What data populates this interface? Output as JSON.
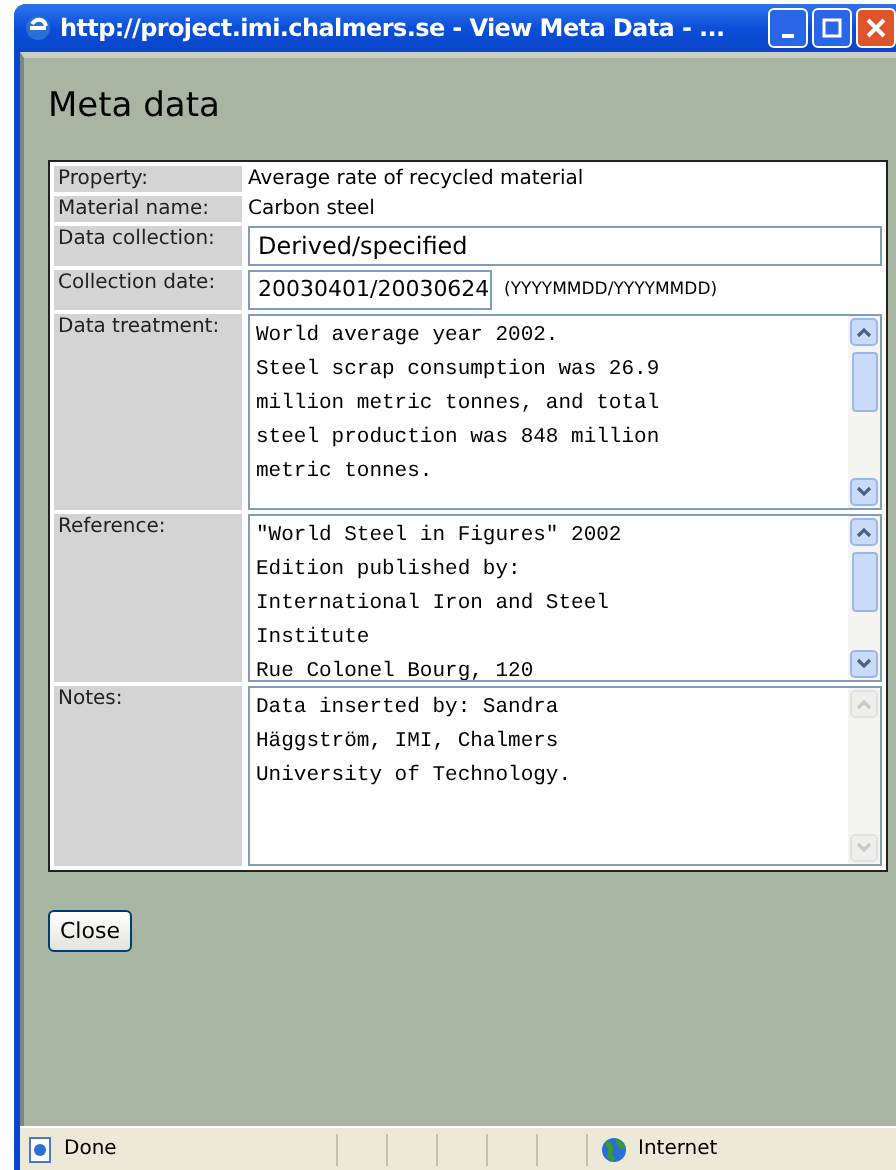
{
  "window": {
    "title": "http://project.imi.chalmers.se - View Meta Data - ..."
  },
  "heading": "Meta data",
  "rows": [
    {
      "kind": "text",
      "label": "Property:",
      "value": "Average rate of recycled material"
    },
    {
      "kind": "text",
      "label": "Material name:",
      "value": "Carbon steel"
    },
    {
      "kind": "input",
      "label": "Data collection:",
      "value": "Derived/specified"
    },
    {
      "kind": "date",
      "label": "Collection date:",
      "value": "20030401/20030624",
      "hint": "(YYYYMMDD/YYYYMMDD)"
    },
    {
      "kind": "textarea",
      "label": "Data treatment:",
      "value": "World average year 2002.\nSteel scrap consumption was 26.9\nmillion metric tonnes, and total\nsteel production was 848 million\nmetric tonnes.",
      "scrollable": true
    },
    {
      "kind": "textarea",
      "label": "Reference:",
      "value": "\"World Steel in Figures\" 2002\nEdition published by:\nInternational Iron and Steel\nInstitute\nRue Colonel Bourg, 120",
      "scrollable": true
    },
    {
      "kind": "textarea",
      "label": "Notes:",
      "value": "Data inserted by: Sandra\nHäggström, IMI, Chalmers\nUniversity of Technology.",
      "scrollable": false
    }
  ],
  "buttons": [
    "Close"
  ],
  "status_bar": {
    "status": "Done",
    "zone": "Internet"
  }
}
